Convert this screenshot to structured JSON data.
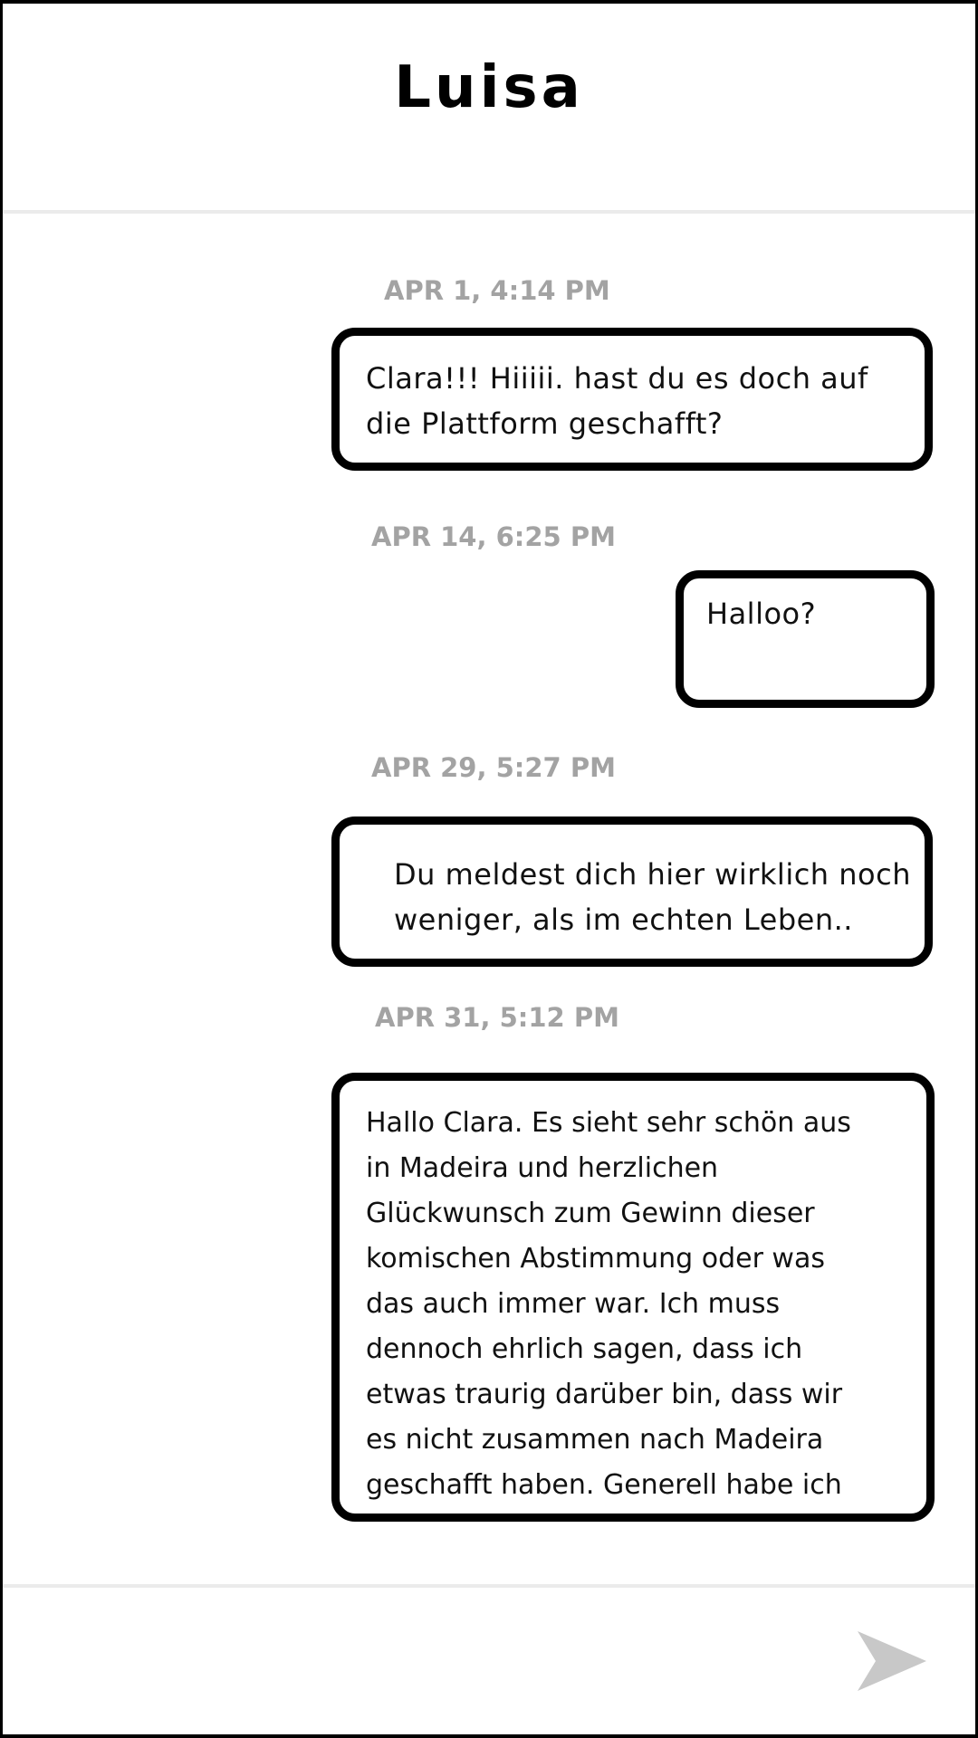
{
  "header": {
    "contact_name": "Luisa"
  },
  "messages": [
    {
      "timestamp": "APR 1, 4:14 PM",
      "text": "Clara!!! Hiiiii. hast du es doch auf\ndie Plattform geschafft?"
    },
    {
      "timestamp": "APR 14, 6:25 PM",
      "text": "Halloo?"
    },
    {
      "timestamp": "APR 29, 5:27 PM",
      "text": "Du meldest dich hier wirklich noch\nweniger, als im echten Leben.."
    },
    {
      "timestamp": "APR 31, 5:12 PM",
      "text": "Hallo Clara. Es sieht sehr schön aus\nin Madeira und herzlichen\nGlückwunsch zum Gewinn dieser\nkomischen Abstimmung oder was\ndas auch immer war. Ich muss\ndennoch ehrlich sagen, dass ich\netwas traurig darüber bin, dass wir\nes nicht zusammen nach Madeira\ngeschafft haben. Generell habe ich"
    }
  ],
  "composer": {
    "send_icon": "send-arrow-icon",
    "send_icon_color": "#c8c8c8"
  },
  "colors": {
    "timestamp": "#a3a3a3",
    "bubble_border": "#000000",
    "divider": "#ebebeb"
  }
}
